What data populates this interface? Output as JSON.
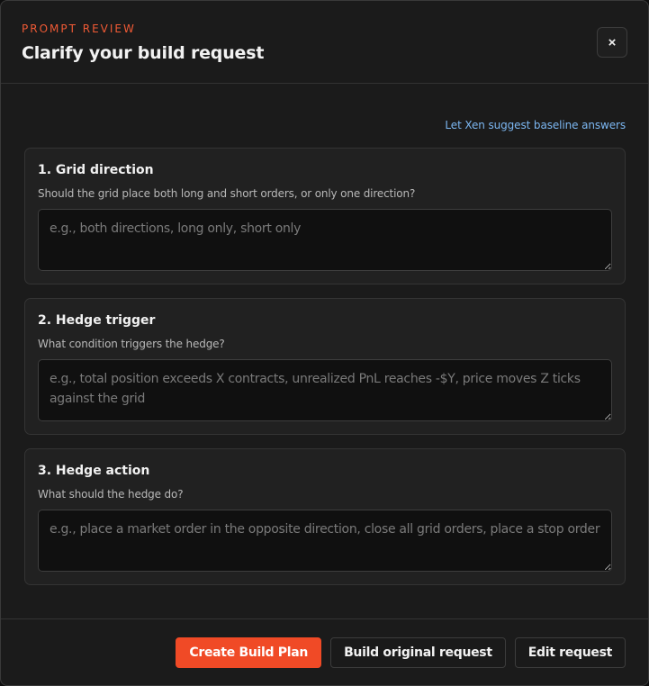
{
  "header": {
    "eyebrow": "PROMPT REVIEW",
    "title": "Clarify your build request",
    "close_label": "×"
  },
  "suggest_link": "Let Xen suggest baseline answers",
  "questions": [
    {
      "title": "1. Grid direction",
      "description": "Should the grid place both long and short orders, or only one direction?",
      "value": "",
      "placeholder": "e.g., both directions, long only, short only"
    },
    {
      "title": "2. Hedge trigger",
      "description": "What condition triggers the hedge?",
      "value": "",
      "placeholder": "e.g., total position exceeds X contracts, unrealized PnL reaches -$Y, price moves Z ticks against the grid"
    },
    {
      "title": "3. Hedge action",
      "description": "What should the hedge do?",
      "value": "",
      "placeholder": "e.g., place a market order in the opposite direction, close all grid orders, place a stop order"
    }
  ],
  "footer": {
    "create_label": "Create Build Plan",
    "build_original_label": "Build original request",
    "edit_label": "Edit request"
  },
  "colors": {
    "accent": "#f04a26",
    "eyebrow": "#f05a35",
    "link": "#7cb7f2",
    "background": "#1b1b1b"
  }
}
